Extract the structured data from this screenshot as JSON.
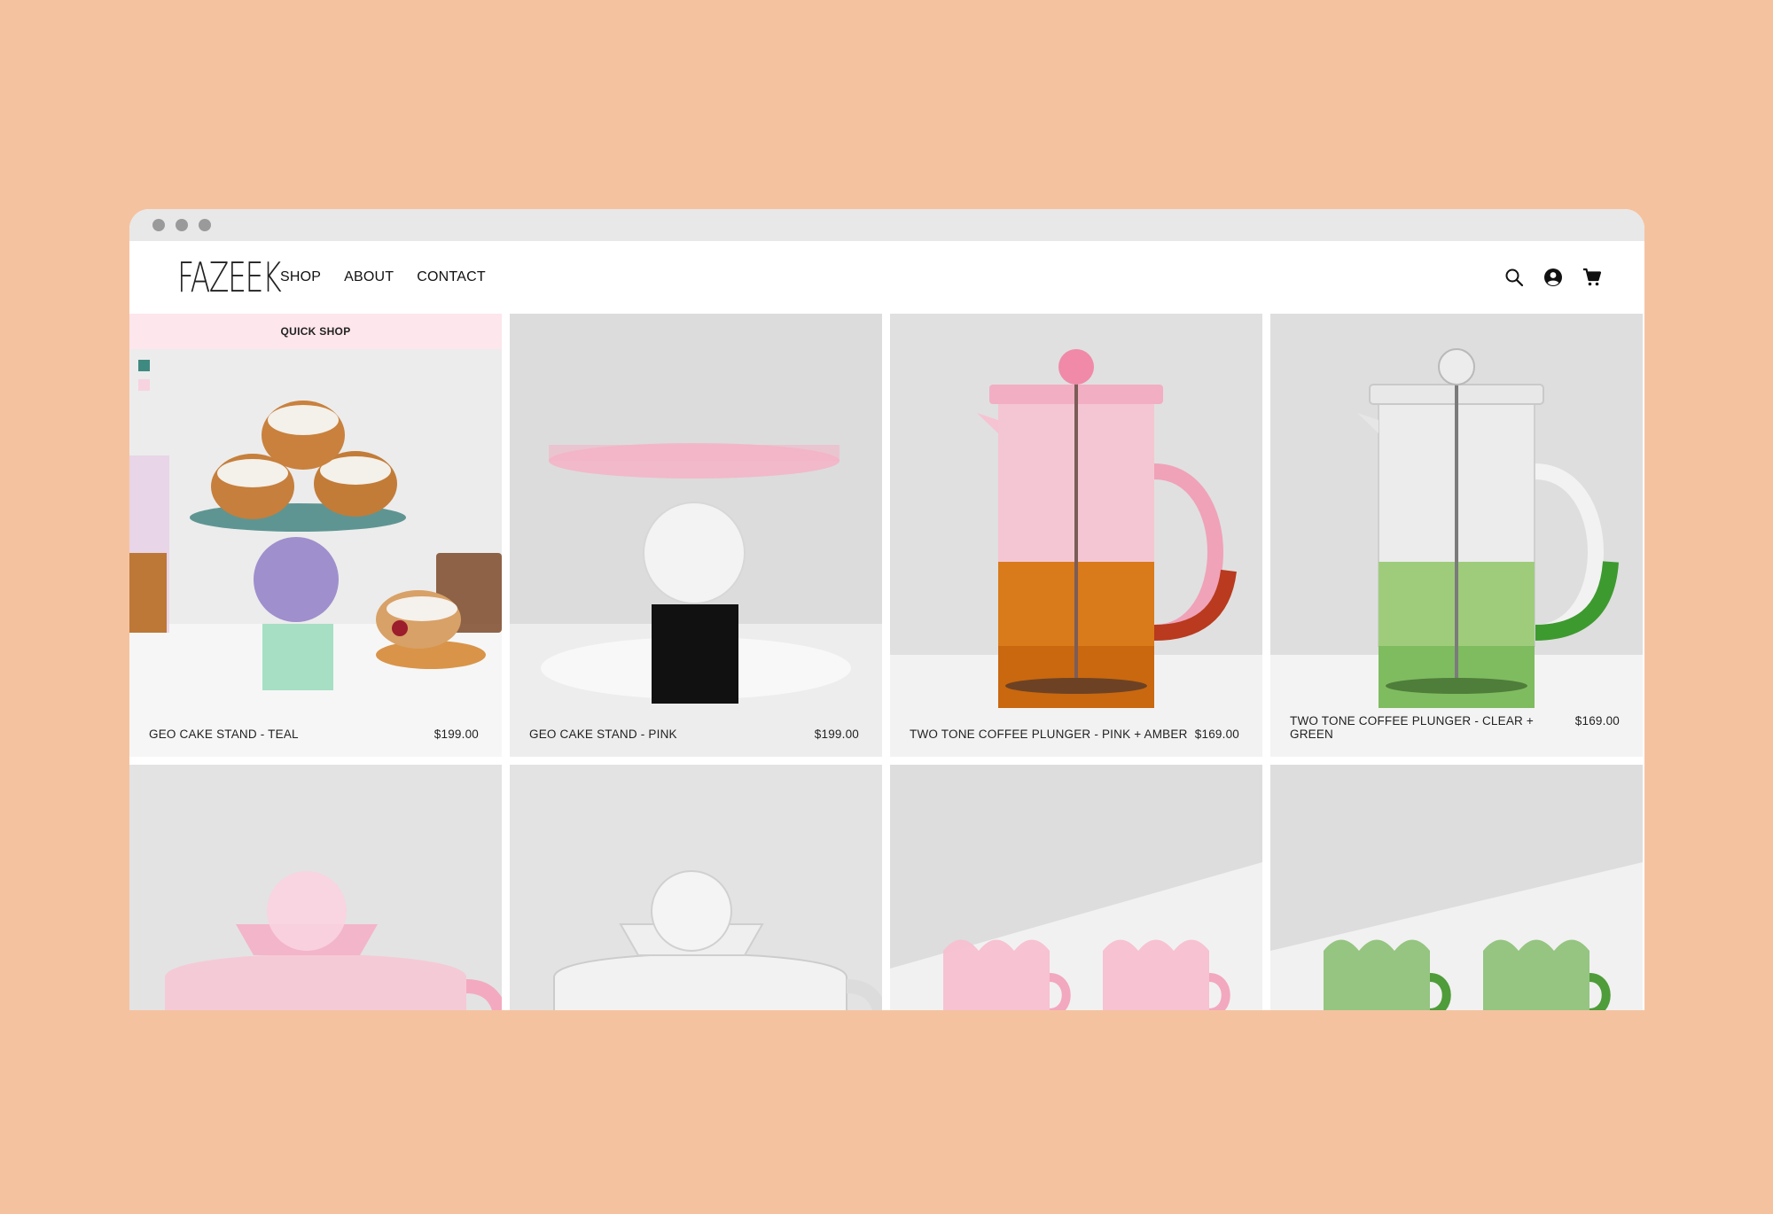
{
  "brand": {
    "logo_text": "FAZEEK"
  },
  "nav": {
    "items": [
      "SHOP",
      "ABOUT",
      "CONTACT"
    ]
  },
  "icons": [
    "search-icon",
    "account-icon",
    "cart-icon"
  ],
  "quick_shop_label": "QUICK SHOP",
  "colors": {
    "page_bg": "#f5c2a0",
    "quick_shop_bg": "#fde6ec",
    "swatch_teal": "#3f8a80",
    "swatch_pink": "#f7d3e0"
  },
  "products": [
    {
      "name": "GEO CAKE STAND - TEAL",
      "price": "$199.00"
    },
    {
      "name": "GEO CAKE STAND - PINK",
      "price": "$199.00"
    },
    {
      "name": "TWO TONE COFFEE PLUNGER - PINK + AMBER",
      "price": "$169.00"
    },
    {
      "name": "TWO TONE COFFEE PLUNGER - CLEAR + GREEN",
      "price": "$169.00"
    }
  ]
}
